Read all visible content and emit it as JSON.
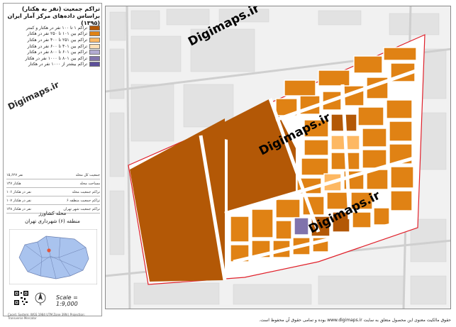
{
  "panel": {
    "title_line1": "تراکم جمعیت (نفر به هکتار)",
    "title_line2": "براساس داده‌های مرکز آمار ایران (۱۳۹۵)"
  },
  "legend": [
    {
      "label": "تراکم ۱ تا ۱۰۰ نفر در هکتار و کمتر",
      "color": "#b35806"
    },
    {
      "label": "تراکم بین ۱۰۱ تا ۲۵۰ نفر در هکتار",
      "color": "#e08214"
    },
    {
      "label": "تراکم بین ۲۵۱ تا ۴۰۰ نفر در هکتار",
      "color": "#fdb863"
    },
    {
      "label": "تراکم بین ۴۰۱ تا ۶۰۰ نفر در هکتار",
      "color": "#fee0b6"
    },
    {
      "label": "تراکم بین ۶۰۱ تا ۸۰۰ نفر در هکتار",
      "color": "#b2abd2"
    },
    {
      "label": "تراکم بین ۸۰۱ تا ۱۰۰۰ نفر در هکتار",
      "color": "#8073ac"
    },
    {
      "label": "تراکم بیشتر از ۱۰۰۰ نفر در هکتار",
      "color": "#5c4f9a"
    }
  ],
  "stats": [
    {
      "label": "جمعیت کل محله",
      "value": "۱۵,۶۲۷ نفر"
    },
    {
      "label": "مساحت محله",
      "value": "۱۴۷ هکتار"
    },
    {
      "label": "تراکم جمعیت محله",
      "value": "۱۰۶ نفر در هکتار"
    },
    {
      "label": "تراکم جمعیت منطقه ۶",
      "value": "۱۰۷ نفر در هکتار"
    },
    {
      "label": "تراکم جمعیت شهر تهران",
      "value": "۱۴۸ نفر در هکتار"
    }
  ],
  "location": {
    "line1": "محله کشاورز",
    "line2": "منطقه (۶) شهرداری تهران"
  },
  "scale": "Scale = 1:9,000",
  "watermark": "Digimaps.ir",
  "copyright": "حقوق مالکیت معنوی این محصول متعلق به سایت www.digimaps.ir بوده و تمامی حقوق آن محفوظ است.",
  "footer_small": "Coord. System: WGS 1984 UTM Zone 39N | Projection: Transverse Mercator",
  "colors": {
    "frame": "#9a9a9a",
    "boundary": "#e0202a",
    "road": "#ffffff",
    "bg": "#f2f2f2"
  }
}
